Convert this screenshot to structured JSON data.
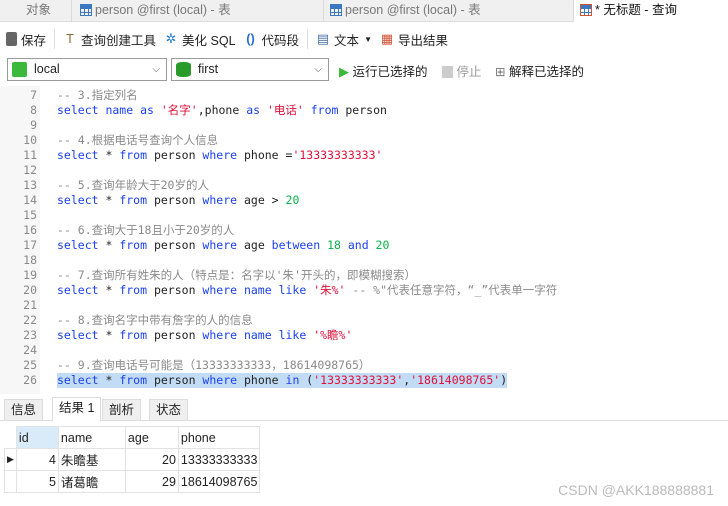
{
  "tabs": [
    {
      "label": "对象"
    },
    {
      "label": "person @first (local) - 表"
    },
    {
      "label": "person @first (local) - 表"
    },
    {
      "label": "* 无标题 - 查询"
    }
  ],
  "toolbar": {
    "save": "保存",
    "query_builder": "查询创建工具",
    "beautify": "美化 SQL",
    "snippet": "代码段",
    "text": "文本",
    "export": "导出结果"
  },
  "selectors": {
    "connection": "local",
    "database": "first",
    "run_selected": "运行已选择的",
    "stop": "停止",
    "explain_selected": "解释已选择的"
  },
  "colors": {
    "keyword": "#1a3ff0",
    "string": "#e0103a",
    "number": "#0bb04a",
    "comment": "#8a8a8a",
    "selection": "#c2dcf5"
  },
  "editor": {
    "lines": [
      {
        "n": "7",
        "t": [
          [
            "cm",
            "-- 3.指定列名"
          ]
        ]
      },
      {
        "n": "8",
        "t": [
          [
            "kw",
            "select name as "
          ],
          [
            "str",
            "'名字'"
          ],
          [
            "pl",
            ",phone "
          ],
          [
            "kw",
            "as "
          ],
          [
            "str",
            "'电话' "
          ],
          [
            "kw",
            "from "
          ],
          [
            "pl",
            "person"
          ]
        ]
      },
      {
        "n": "9",
        "t": []
      },
      {
        "n": "10",
        "t": [
          [
            "cm",
            "-- 4.根据电话号查询个人信息"
          ]
        ]
      },
      {
        "n": "11",
        "t": [
          [
            "kw",
            "select "
          ],
          [
            "pl",
            "* "
          ],
          [
            "kw",
            "from "
          ],
          [
            "pl",
            "person "
          ],
          [
            "kw",
            "where "
          ],
          [
            "pl",
            "phone ="
          ],
          [
            "str",
            "'13333333333'"
          ]
        ]
      },
      {
        "n": "12",
        "t": []
      },
      {
        "n": "13",
        "t": [
          [
            "cm",
            "-- 5.查询年龄大于20岁的人"
          ]
        ]
      },
      {
        "n": "14",
        "t": [
          [
            "kw",
            "select "
          ],
          [
            "pl",
            "* "
          ],
          [
            "kw",
            "from "
          ],
          [
            "pl",
            "person "
          ],
          [
            "kw",
            "where "
          ],
          [
            "pl",
            "age > "
          ],
          [
            "num",
            "20"
          ]
        ]
      },
      {
        "n": "15",
        "t": []
      },
      {
        "n": "16",
        "t": [
          [
            "cm",
            "-- 6.查询大于18且小于20岁的人"
          ]
        ]
      },
      {
        "n": "17",
        "t": [
          [
            "kw",
            "select "
          ],
          [
            "pl",
            "* "
          ],
          [
            "kw",
            "from "
          ],
          [
            "pl",
            "person "
          ],
          [
            "kw",
            "where "
          ],
          [
            "pl",
            "age "
          ],
          [
            "kw",
            "between "
          ],
          [
            "num",
            "18 "
          ],
          [
            "kw",
            "and "
          ],
          [
            "num",
            "20"
          ]
        ]
      },
      {
        "n": "18",
        "t": []
      },
      {
        "n": "19",
        "t": [
          [
            "cm",
            "-- 7.查询所有姓朱的人（特点是：名字以'朱'开头的，即模糊搜索）"
          ]
        ]
      },
      {
        "n": "20",
        "t": [
          [
            "kw",
            "select "
          ],
          [
            "pl",
            "* "
          ],
          [
            "kw",
            "from "
          ],
          [
            "pl",
            "person "
          ],
          [
            "kw",
            "where name like "
          ],
          [
            "str",
            "'朱%' "
          ],
          [
            "cm",
            "-- %\"代表任意字符，“_”代表单一字符"
          ]
        ]
      },
      {
        "n": "21",
        "t": []
      },
      {
        "n": "22",
        "t": [
          [
            "cm",
            "-- 8.查询名字中带有詹字的人的信息"
          ]
        ]
      },
      {
        "n": "23",
        "t": [
          [
            "kw",
            "select "
          ],
          [
            "pl",
            "* "
          ],
          [
            "kw",
            "from "
          ],
          [
            "pl",
            "person "
          ],
          [
            "kw",
            "where name like "
          ],
          [
            "str",
            "'%瞻%'"
          ]
        ]
      },
      {
        "n": "24",
        "t": []
      },
      {
        "n": "25",
        "t": [
          [
            "cm",
            "-- 9.查询电话号可能是（13333333333，18614098765）"
          ]
        ]
      },
      {
        "n": "26",
        "sel": true,
        "t": [
          [
            "kw",
            "select "
          ],
          [
            "pl",
            "* "
          ],
          [
            "kw",
            "from "
          ],
          [
            "pl",
            "person "
          ],
          [
            "kw",
            "where "
          ],
          [
            "pl",
            "phone "
          ],
          [
            "kw",
            "in "
          ],
          [
            "pl",
            "("
          ],
          [
            "str",
            "'13333333333'"
          ],
          [
            "pl",
            ","
          ],
          [
            "str",
            "'18614098765'"
          ],
          [
            "pl",
            ")"
          ]
        ]
      }
    ]
  },
  "result_tabs": [
    {
      "label": "信息"
    },
    {
      "label": "结果 1"
    },
    {
      "label": "剖析"
    },
    {
      "label": "状态"
    }
  ],
  "grid": {
    "columns": [
      "id",
      "name",
      "age",
      "phone"
    ],
    "rows": [
      [
        "4",
        "朱瞻基",
        "20",
        "13333333333"
      ],
      [
        "5",
        "诸葛瞻",
        "29",
        "18614098765"
      ]
    ]
  },
  "watermark": "CSDN @AKK188888881"
}
